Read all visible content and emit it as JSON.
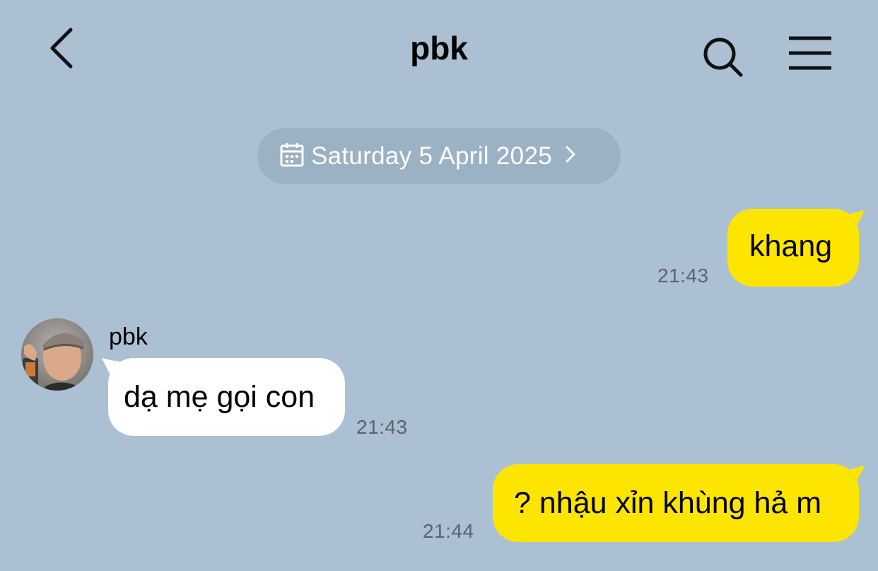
{
  "header": {
    "title": "pbk",
    "back_icon": "chevron-left-icon",
    "search_icon": "search-icon",
    "menu_icon": "hamburger-menu-icon"
  },
  "date_divider": {
    "label": "Saturday 5 April 2025",
    "icon": "calendar-icon"
  },
  "colors": {
    "background": "#abc1d3",
    "outgoing_bubble": "#fee500",
    "incoming_bubble": "#ffffff",
    "date_pill": "#9bb1c4",
    "timestamp": "#5b636c"
  },
  "messages": [
    {
      "direction": "outgoing",
      "text": "khang",
      "time": "21:43"
    },
    {
      "direction": "incoming",
      "sender": "pbk",
      "text": "dạ mẹ gọi con",
      "time": "21:43"
    },
    {
      "direction": "outgoing",
      "text": "? nhậu xỉn khùng hả m",
      "time": "21:44"
    }
  ]
}
